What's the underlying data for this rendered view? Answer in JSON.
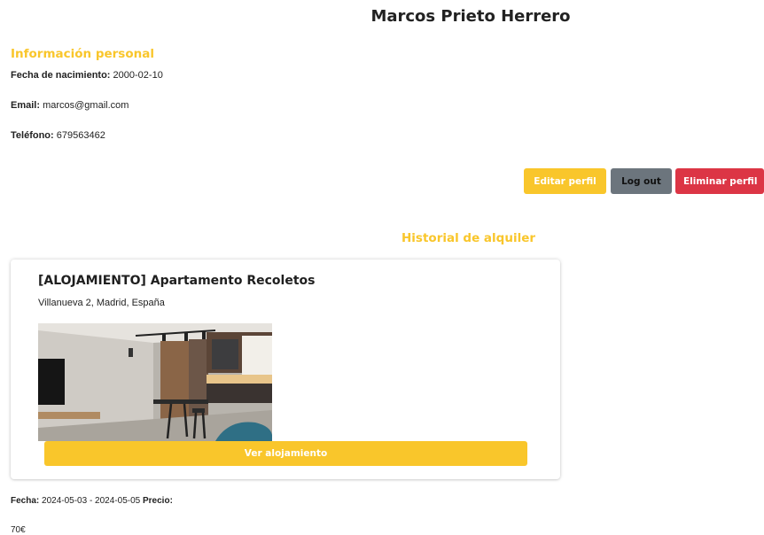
{
  "profile": {
    "name": "Marcos Prieto Herrero",
    "personal_heading": "Información personal",
    "dob_label": "Fecha de nacimiento:",
    "dob_value": "2000-02-10",
    "email_label": "Email:",
    "email_value": "marcos@gmail.com",
    "phone_label": "Teléfono:",
    "phone_value": "679563462"
  },
  "actions": {
    "edit_label": "Editar perfil",
    "logout_label": "Log out",
    "delete_label": "Eliminar perfil"
  },
  "history": {
    "heading": "Historial de alquiler",
    "items": [
      {
        "title": "[ALOJAMIENTO] Apartamento Recoletos",
        "address": "Villanueva 2, Madrid, España",
        "view_label": "Ver alojamiento",
        "date_label": "Fecha:",
        "date_value": "2024-05-03 - 2024-05-05",
        "price_label": "Precio:",
        "price_value": "70€"
      }
    ]
  },
  "colors": {
    "accent": "#f9c62b",
    "logout": "#6c757d",
    "danger": "#dc3545"
  }
}
